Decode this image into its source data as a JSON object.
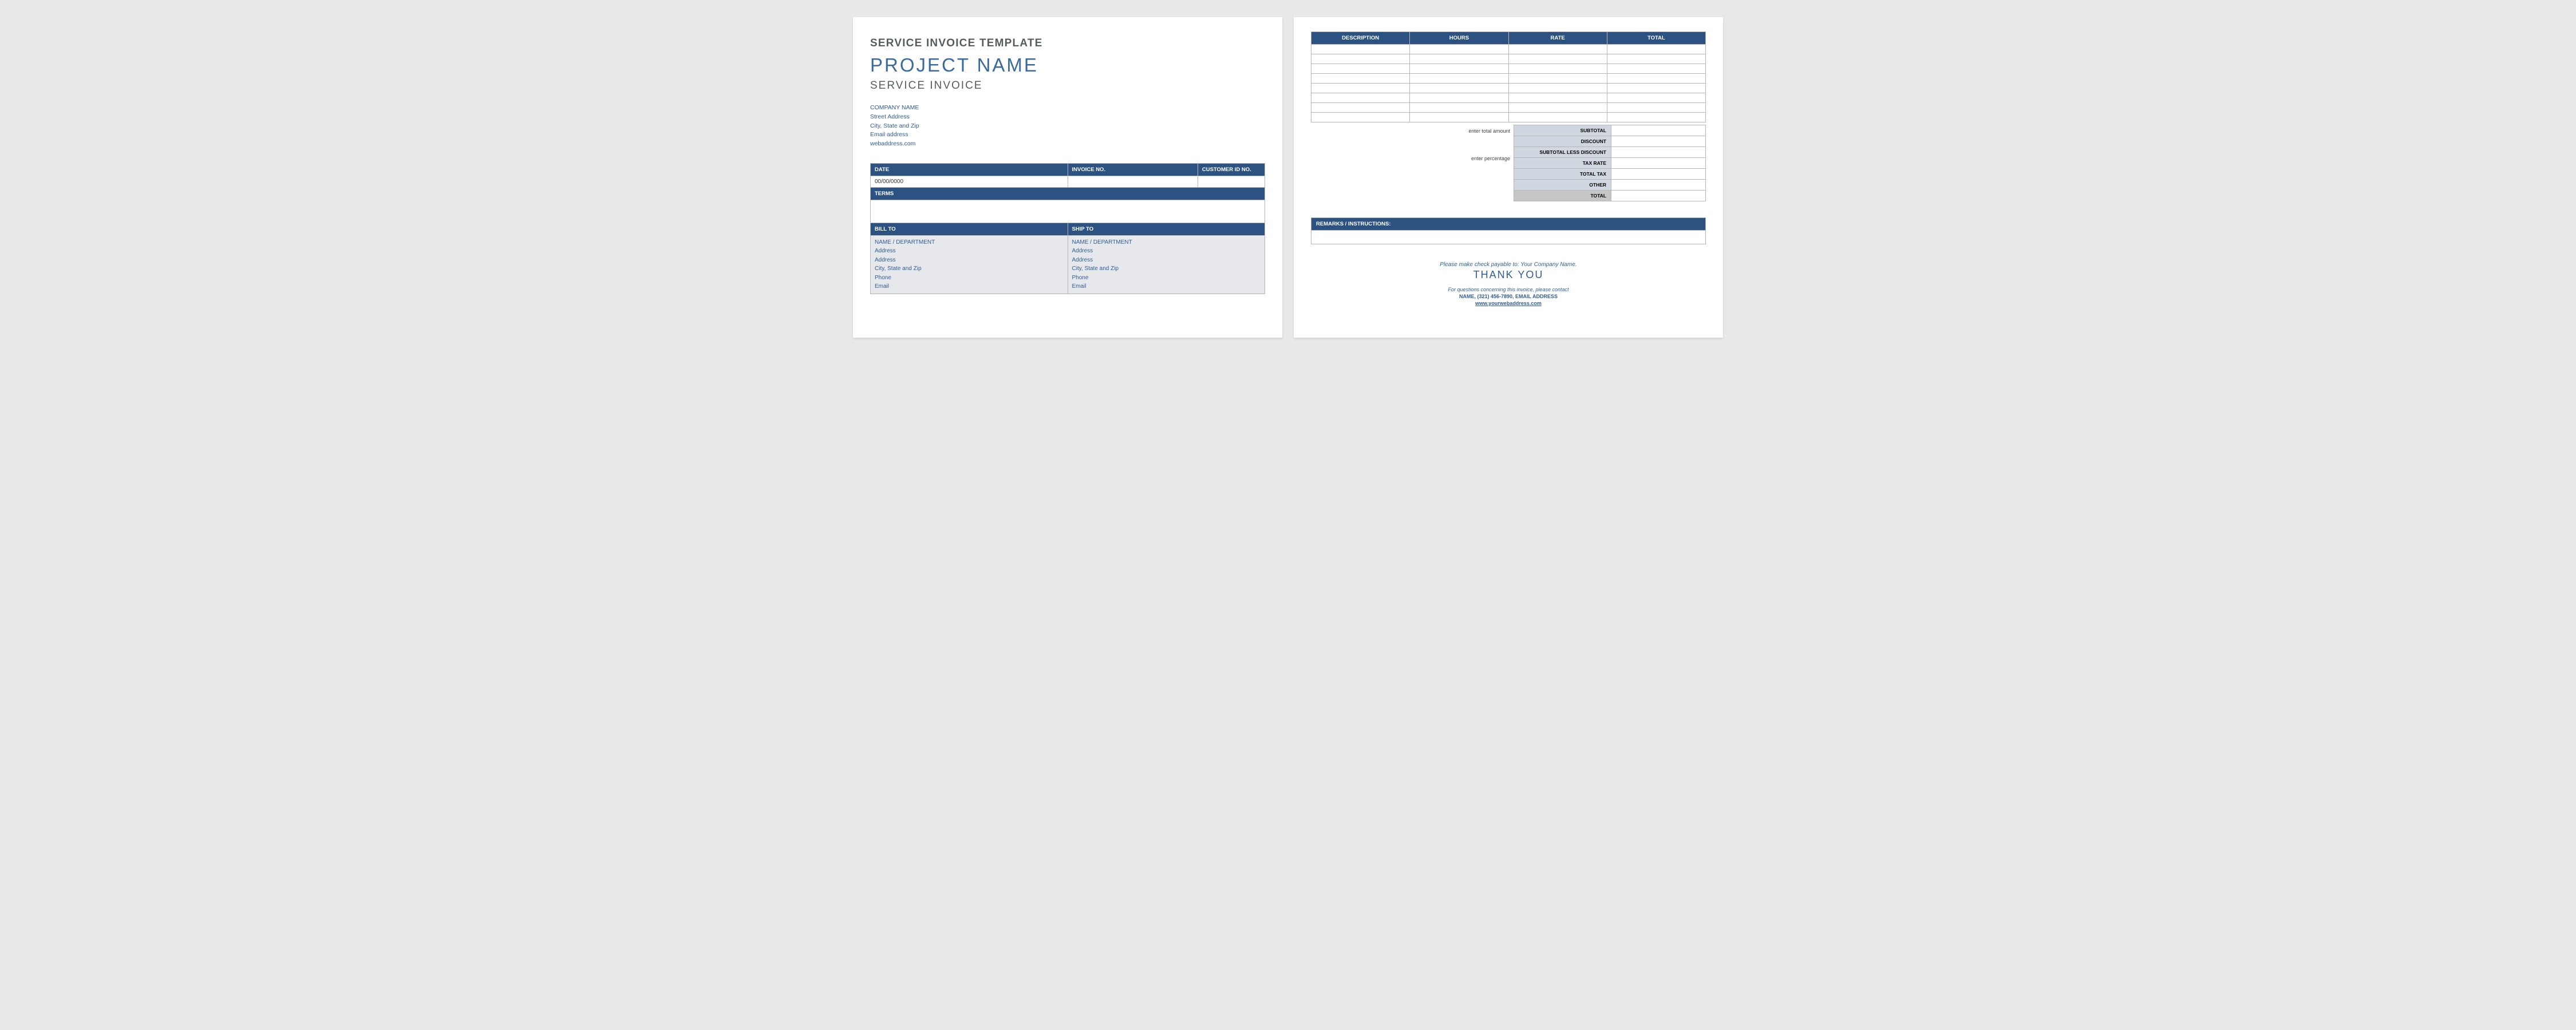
{
  "page1": {
    "template_title": "SERVICE INVOICE TEMPLATE",
    "project_name": "PROJECT NAME",
    "service_invoice": "SERVICE INVOICE",
    "company": {
      "name": "COMPANY NAME",
      "street": "Street Address",
      "city_state_zip": "City, State and Zip",
      "email": "Email address",
      "website": "webaddress.com"
    },
    "meta": {
      "date_header": "DATE",
      "invoice_no_header": "INVOICE NO.",
      "customer_id_header": "CUSTOMER ID NO.",
      "date_value": "00/00/0000",
      "terms_header": "TERMS"
    },
    "bill_to_header": "BILL TO",
    "ship_to_header": "SHIP TO",
    "bill_to": {
      "name": "NAME / DEPARTMENT",
      "addr1": "Address",
      "addr2": "Address",
      "city": "City, State and Zip",
      "phone": "Phone",
      "email": "Email"
    },
    "ship_to": {
      "name": "NAME / DEPARTMENT",
      "addr1": "Address",
      "addr2": "Address",
      "city": "City, State and Zip",
      "phone": "Phone",
      "email": "Email"
    }
  },
  "page2": {
    "columns": {
      "description": "DESCRIPTION",
      "hours": "HOURS",
      "rate": "RATE",
      "total": "TOTAL"
    },
    "row_count": 8,
    "hints": {
      "enter_total": "enter total amount",
      "enter_percentage": "enter percentage"
    },
    "totals": {
      "subtotal": "SUBTOTAL",
      "discount": "DISCOUNT",
      "subtotal_less_discount": "SUBTOTAL LESS DISCOUNT",
      "tax_rate": "TAX RATE",
      "total_tax": "TOTAL TAX",
      "other": "OTHER",
      "total": "TOTAL"
    },
    "remarks_header": "REMARKS / INSTRUCTIONS:",
    "footer": {
      "payable": "Please make check payable to: Your Company Name.",
      "thank_you": "THANK YOU",
      "contact_text": "For questions concerning this invoice, please contact",
      "contact_line": "NAME, (321) 456-7890, EMAIL ADDRESS",
      "web": "www.yourwebaddress.com"
    }
  }
}
